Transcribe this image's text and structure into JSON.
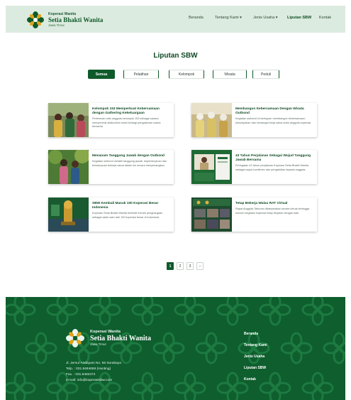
{
  "header": {
    "brand_small": "Koperasi Wanita",
    "brand_name": "Setia Bhakti Wanita",
    "brand_sub": "Jawa Timur",
    "nav": [
      {
        "label": "Beranda"
      },
      {
        "label": "Tentang Kami ▾"
      },
      {
        "label": "Jenis Usaha ▾"
      },
      {
        "label": "Liputan SBW"
      },
      {
        "label": "Kontak"
      }
    ],
    "active_nav": "Liputan SBW"
  },
  "page": {
    "title": "Liputan SBW",
    "filters": [
      "Semua",
      "Pelatihan",
      "Kelompok",
      "Wisata",
      "Peduli"
    ],
    "active_filter": "Semua"
  },
  "articles": [
    {
      "title": "Kelompok 153 Memperkuat Kebersamaan dengan Gathering Kekeluargaan",
      "desc": "Pertemuan rutin anggota kelompok 153 sebagai sarana mempererat silaturahmi serta berbagi pengalaman usaha bersama.",
      "thumb_icon": "photo-group-icon"
    },
    {
      "title": "Membangun Kebersamaan Dengan Wisata Outbond",
      "desc": "Kegiatan outbond ini bertujuan membangun kebersamaan, kekompakan dan semangat kerja sama antar anggota koperasi.",
      "thumb_icon": "photo-group-icon"
    },
    {
      "title": "Menanam Tanggung Jawab dengan Outbond",
      "desc": "Kegiatan outbond melatih tanggung jawab, kepemimpinan dan kemampuan bekerja sama dalam tim secara menyenangkan.",
      "thumb_icon": "photo-garden-icon"
    },
    {
      "title": "43 Tahun Perjalanan Sebagai Wujud Tanggung Jawab Bersama",
      "desc": "Peringatan 43 tahun perjalanan Koperasi Setia Bhakti Wanita sebagai wujud komitmen dan pengabdian kepada anggota.",
      "thumb_icon": "photo-event-icon"
    },
    {
      "title": "SBW Kembali Masuk 100 Koperasi Besar Indonesia",
      "desc": "Koperasi Setia Bhakti Wanita kembali meraih penghargaan sebagai salah satu dari 100 koperasi besar di Indonesia.",
      "thumb_icon": "photo-award-icon"
    },
    {
      "title": "Tetap Bekerja Walau RAT Virtual",
      "desc": "Rapat Anggota Tahunan dilaksanakan secara virtual sehingga seluruh kegiatan koperasi tetap berjalan dengan baik.",
      "thumb_icon": "photo-virtual-meeting-icon"
    }
  ],
  "pagination": {
    "pages": [
      "1",
      "2",
      "3",
      "›"
    ],
    "active": "1"
  },
  "footer": {
    "brand_small": "Koperasi Wanita",
    "brand_name": "Setia Bhakti Wanita",
    "brand_sub": "Jawa Timur",
    "contact": [
      "Jl. Jemur Andayani No. 55 Surabaya",
      "Telp. : 031.8494659 (Hunting)",
      "Fax. : 031.8483474",
      "e-mail: info@koperasisbw.com"
    ],
    "links": [
      "Beranda",
      "Tentang Kami",
      "Jenis Usaha",
      "Liputan SBW",
      "Kontak"
    ]
  },
  "colors": {
    "brand_green": "#0f5a2b",
    "header_bg": "#dcebdf",
    "footer_bg": "#0e5e2e"
  }
}
